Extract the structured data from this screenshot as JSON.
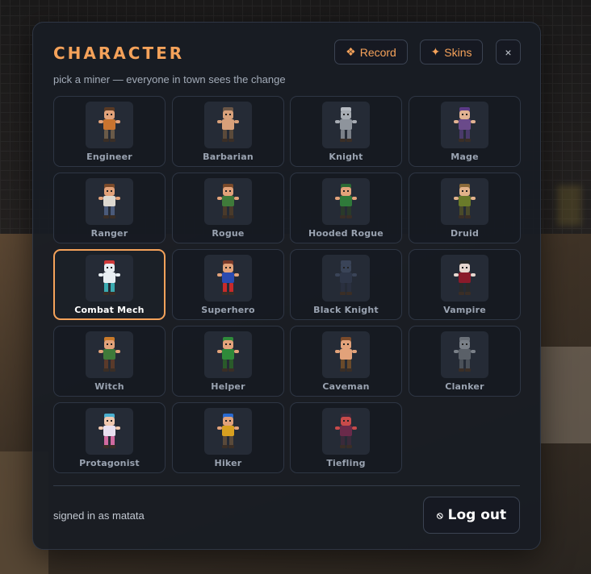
{
  "header": {
    "title": "CHARACTER",
    "subtitle": "pick a miner — everyone in town sees the change",
    "record_icon": "❖",
    "record_label": "Record",
    "skins_icon": "✦",
    "skins_label": "Skins",
    "close_label": "×"
  },
  "selected": "Combat Mech",
  "characters": [
    {
      "name": "Engineer",
      "icon": "engineer-avatar",
      "colors": {
        "skin": "#e2a27a",
        "body": "#c9742f",
        "head": "#5a3a24",
        "legs": "#6a5a48"
      }
    },
    {
      "name": "Barbarian",
      "icon": "barbarian-avatar",
      "colors": {
        "skin": "#d8a07a",
        "body": "#d8a07a",
        "head": "#6b5646",
        "legs": "#5b4a3a"
      }
    },
    {
      "name": "Knight",
      "icon": "knight-avatar",
      "colors": {
        "skin": "#a7acb3",
        "body": "#8e949c",
        "head": "#b5bac1",
        "legs": "#7b8088"
      }
    },
    {
      "name": "Mage",
      "icon": "mage-avatar",
      "colors": {
        "skin": "#e2b292",
        "body": "#6a4a8a",
        "head": "#5b3a86",
        "legs": "#4a3a6a"
      }
    },
    {
      "name": "Ranger",
      "icon": "ranger-avatar",
      "colors": {
        "skin": "#e2a27a",
        "body": "#dcd8d0",
        "head": "#7a4a2a",
        "legs": "#4a5a7a"
      }
    },
    {
      "name": "Rogue",
      "icon": "rogue-avatar",
      "colors": {
        "skin": "#e2a27a",
        "body": "#3f7a3a",
        "head": "#7a4a2a",
        "legs": "#4a3a2a"
      }
    },
    {
      "name": "Hooded Rogue",
      "icon": "hooded-rogue-avatar",
      "colors": {
        "skin": "#e2a27a",
        "body": "#2f7a3a",
        "head": "#2a6a34",
        "legs": "#2a3a2a"
      }
    },
    {
      "name": "Druid",
      "icon": "druid-avatar",
      "colors": {
        "skin": "#e2b28a",
        "body": "#6a7a2a",
        "head": "#8a6a3a",
        "legs": "#4a4a2a"
      }
    },
    {
      "name": "Combat Mech",
      "icon": "combat-mech-avatar",
      "colors": {
        "skin": "#e8eef2",
        "body": "#e8eef2",
        "head": "#d03a3a",
        "legs": "#3aaab0"
      }
    },
    {
      "name": "Superhero",
      "icon": "superhero-avatar",
      "colors": {
        "skin": "#e2a27a",
        "body": "#2a4ab0",
        "head": "#7a3a2a",
        "legs": "#c82a2a"
      }
    },
    {
      "name": "Black Knight",
      "icon": "black-knight-avatar",
      "colors": {
        "skin": "#3a4458",
        "body": "#2e3648",
        "head": "#3a4458",
        "legs": "#2a3040"
      }
    },
    {
      "name": "Vampire",
      "icon": "vampire-avatar",
      "colors": {
        "skin": "#e8d8d0",
        "body": "#8a1a2a",
        "head": "#2a2a2a",
        "legs": "#2a2a2a"
      }
    },
    {
      "name": "Witch",
      "icon": "witch-avatar",
      "colors": {
        "skin": "#e2a27a",
        "body": "#3f7a3a",
        "head": "#c97a2a",
        "legs": "#5a3a2a"
      }
    },
    {
      "name": "Helper",
      "icon": "helper-avatar",
      "colors": {
        "skin": "#e2a27a",
        "body": "#2f8a3a",
        "head": "#2f8a3a",
        "legs": "#2a5a2a"
      }
    },
    {
      "name": "Caveman",
      "icon": "caveman-avatar",
      "colors": {
        "skin": "#e2a27a",
        "body": "#e2a27a",
        "head": "#7a4a2a",
        "legs": "#6a4a2a"
      }
    },
    {
      "name": "Clanker",
      "icon": "clanker-avatar",
      "colors": {
        "skin": "#7a8088",
        "body": "#5a6068",
        "head": "#6a7078",
        "legs": "#4a5058"
      }
    },
    {
      "name": "Protagonist",
      "icon": "protagonist-avatar",
      "colors": {
        "skin": "#f0c8b0",
        "body": "#e8e0f0",
        "head": "#4ab0d0",
        "legs": "#d06aa0"
      }
    },
    {
      "name": "Hiker",
      "icon": "hiker-avatar",
      "colors": {
        "skin": "#e2a27a",
        "body": "#d8a020",
        "head": "#2a6ad0",
        "legs": "#5a4a3a"
      }
    },
    {
      "name": "Tiefling",
      "icon": "tiefling-avatar",
      "colors": {
        "skin": "#c84a4a",
        "body": "#6a2a4a",
        "head": "#3a2a3a",
        "legs": "#3a2a3a"
      }
    }
  ],
  "footer": {
    "signed_in": "signed in as matata",
    "logout_icon": "⦸",
    "logout_label": "Log out"
  },
  "accent_color": "#f5a25a"
}
